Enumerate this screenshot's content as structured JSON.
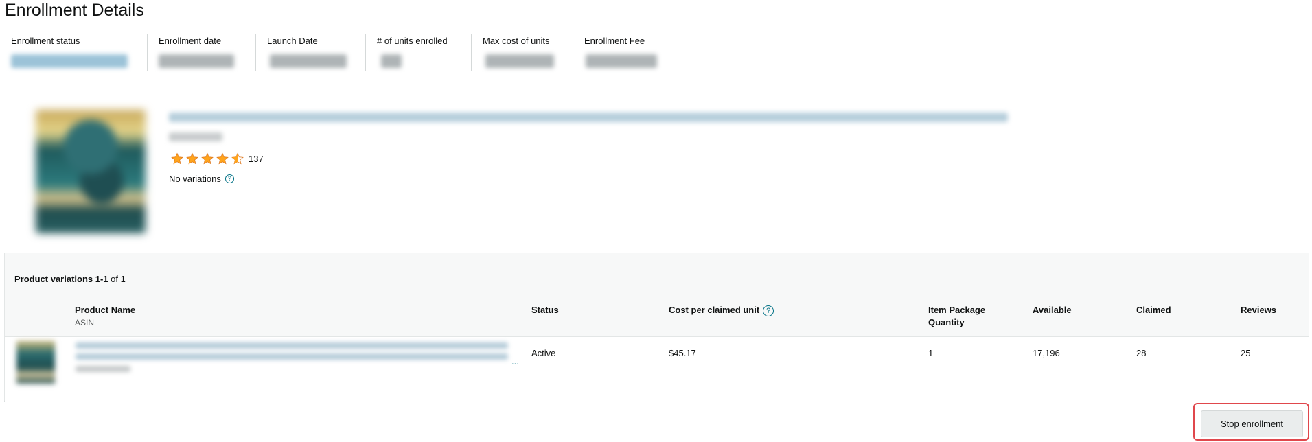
{
  "page": {
    "title": "Enrollment Details"
  },
  "summary": [
    {
      "label": "Enrollment status",
      "value_kind": "link"
    },
    {
      "label": "Enrollment date",
      "value_kind": "text"
    },
    {
      "label": "Launch Date",
      "value_kind": "text"
    },
    {
      "label": "# of units enrolled",
      "value_kind": "text"
    },
    {
      "label": "Max cost of units",
      "value_kind": "text"
    },
    {
      "label": "Enrollment Fee",
      "value_kind": "text"
    }
  ],
  "product": {
    "rating": 4.5,
    "rating_count": "137",
    "variations_text": "No variations",
    "help_icon": "help-circle-icon"
  },
  "table": {
    "count_prefix": "Product variations 1-1",
    "count_suffix": "of 1",
    "headers": {
      "product_name": "Product Name",
      "asin": "ASIN",
      "status": "Status",
      "cost": "Cost per claimed unit",
      "package_qty": "Item Package Quantity",
      "available": "Available",
      "claimed": "Claimed",
      "reviews": "Reviews"
    },
    "rows": [
      {
        "ellipsis": "...",
        "status": "Active",
        "cost": "$45.17",
        "package_qty": "1",
        "available": "17,196",
        "claimed": "28",
        "reviews": "25"
      }
    ]
  },
  "actions": {
    "stop_label": "Stop enrollment"
  },
  "colors": {
    "link": "#007185",
    "star": "#ffa41c",
    "highlight": "#e0474c",
    "panel": "#f7f8f8"
  }
}
